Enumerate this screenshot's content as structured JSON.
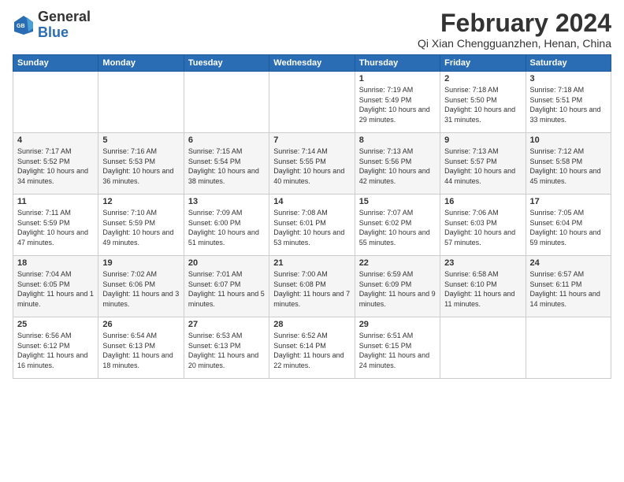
{
  "logo": {
    "text_general": "General",
    "text_blue": "Blue"
  },
  "title": "February 2024",
  "subtitle": "Qi Xian Chengguanzhen, Henan, China",
  "days_of_week": [
    "Sunday",
    "Monday",
    "Tuesday",
    "Wednesday",
    "Thursday",
    "Friday",
    "Saturday"
  ],
  "weeks": [
    [
      {
        "day": "",
        "info": ""
      },
      {
        "day": "",
        "info": ""
      },
      {
        "day": "",
        "info": ""
      },
      {
        "day": "",
        "info": ""
      },
      {
        "day": "1",
        "info": "Sunrise: 7:19 AM\nSunset: 5:49 PM\nDaylight: 10 hours and 29 minutes."
      },
      {
        "day": "2",
        "info": "Sunrise: 7:18 AM\nSunset: 5:50 PM\nDaylight: 10 hours and 31 minutes."
      },
      {
        "day": "3",
        "info": "Sunrise: 7:18 AM\nSunset: 5:51 PM\nDaylight: 10 hours and 33 minutes."
      }
    ],
    [
      {
        "day": "4",
        "info": "Sunrise: 7:17 AM\nSunset: 5:52 PM\nDaylight: 10 hours and 34 minutes."
      },
      {
        "day": "5",
        "info": "Sunrise: 7:16 AM\nSunset: 5:53 PM\nDaylight: 10 hours and 36 minutes."
      },
      {
        "day": "6",
        "info": "Sunrise: 7:15 AM\nSunset: 5:54 PM\nDaylight: 10 hours and 38 minutes."
      },
      {
        "day": "7",
        "info": "Sunrise: 7:14 AM\nSunset: 5:55 PM\nDaylight: 10 hours and 40 minutes."
      },
      {
        "day": "8",
        "info": "Sunrise: 7:13 AM\nSunset: 5:56 PM\nDaylight: 10 hours and 42 minutes."
      },
      {
        "day": "9",
        "info": "Sunrise: 7:13 AM\nSunset: 5:57 PM\nDaylight: 10 hours and 44 minutes."
      },
      {
        "day": "10",
        "info": "Sunrise: 7:12 AM\nSunset: 5:58 PM\nDaylight: 10 hours and 45 minutes."
      }
    ],
    [
      {
        "day": "11",
        "info": "Sunrise: 7:11 AM\nSunset: 5:59 PM\nDaylight: 10 hours and 47 minutes."
      },
      {
        "day": "12",
        "info": "Sunrise: 7:10 AM\nSunset: 5:59 PM\nDaylight: 10 hours and 49 minutes."
      },
      {
        "day": "13",
        "info": "Sunrise: 7:09 AM\nSunset: 6:00 PM\nDaylight: 10 hours and 51 minutes."
      },
      {
        "day": "14",
        "info": "Sunrise: 7:08 AM\nSunset: 6:01 PM\nDaylight: 10 hours and 53 minutes."
      },
      {
        "day": "15",
        "info": "Sunrise: 7:07 AM\nSunset: 6:02 PM\nDaylight: 10 hours and 55 minutes."
      },
      {
        "day": "16",
        "info": "Sunrise: 7:06 AM\nSunset: 6:03 PM\nDaylight: 10 hours and 57 minutes."
      },
      {
        "day": "17",
        "info": "Sunrise: 7:05 AM\nSunset: 6:04 PM\nDaylight: 10 hours and 59 minutes."
      }
    ],
    [
      {
        "day": "18",
        "info": "Sunrise: 7:04 AM\nSunset: 6:05 PM\nDaylight: 11 hours and 1 minute."
      },
      {
        "day": "19",
        "info": "Sunrise: 7:02 AM\nSunset: 6:06 PM\nDaylight: 11 hours and 3 minutes."
      },
      {
        "day": "20",
        "info": "Sunrise: 7:01 AM\nSunset: 6:07 PM\nDaylight: 11 hours and 5 minutes."
      },
      {
        "day": "21",
        "info": "Sunrise: 7:00 AM\nSunset: 6:08 PM\nDaylight: 11 hours and 7 minutes."
      },
      {
        "day": "22",
        "info": "Sunrise: 6:59 AM\nSunset: 6:09 PM\nDaylight: 11 hours and 9 minutes."
      },
      {
        "day": "23",
        "info": "Sunrise: 6:58 AM\nSunset: 6:10 PM\nDaylight: 11 hours and 11 minutes."
      },
      {
        "day": "24",
        "info": "Sunrise: 6:57 AM\nSunset: 6:11 PM\nDaylight: 11 hours and 14 minutes."
      }
    ],
    [
      {
        "day": "25",
        "info": "Sunrise: 6:56 AM\nSunset: 6:12 PM\nDaylight: 11 hours and 16 minutes."
      },
      {
        "day": "26",
        "info": "Sunrise: 6:54 AM\nSunset: 6:13 PM\nDaylight: 11 hours and 18 minutes."
      },
      {
        "day": "27",
        "info": "Sunrise: 6:53 AM\nSunset: 6:13 PM\nDaylight: 11 hours and 20 minutes."
      },
      {
        "day": "28",
        "info": "Sunrise: 6:52 AM\nSunset: 6:14 PM\nDaylight: 11 hours and 22 minutes."
      },
      {
        "day": "29",
        "info": "Sunrise: 6:51 AM\nSunset: 6:15 PM\nDaylight: 11 hours and 24 minutes."
      },
      {
        "day": "",
        "info": ""
      },
      {
        "day": "",
        "info": ""
      }
    ]
  ]
}
